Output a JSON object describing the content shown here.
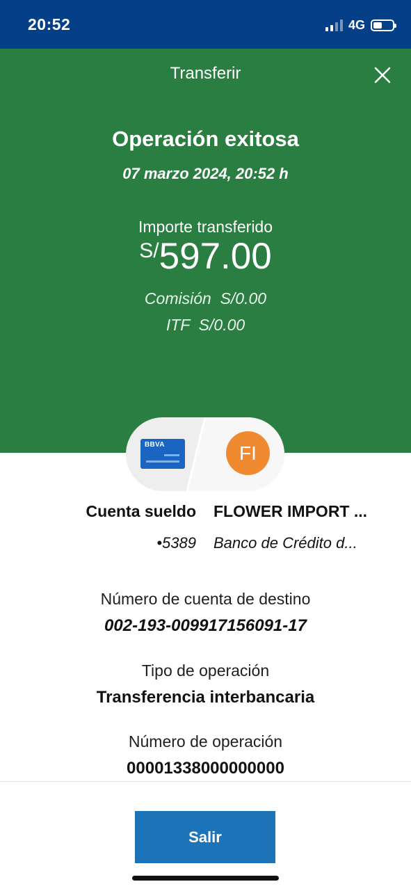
{
  "status_bar": {
    "time": "20:52",
    "network": "4G",
    "signal_bars_active": 2,
    "signal_bars_total": 4,
    "battery_level": 0.45
  },
  "header": {
    "title": "Transferir",
    "close_icon": "close-icon"
  },
  "result": {
    "headline": "Operación exitosa",
    "datetime": "07 marzo 2024, 20:52 h",
    "amount_label": "Importe transferido",
    "currency": "S/",
    "amount": "597.00",
    "commission": "Comisión  S/0.00",
    "itf": "ITF  S/0.00"
  },
  "accounts": {
    "origin": {
      "bank_logo_text": "BBVA",
      "name": "Cuenta sueldo",
      "number": "•5389"
    },
    "destination": {
      "initials": "FI",
      "name": "FLOWER IMPORT ...",
      "bank": "Banco de Crédito d..."
    }
  },
  "details": {
    "dest_account_label": "Número de cuenta de destino",
    "dest_account_value": "002-193-009917156091-17",
    "op_type_label": "Tipo de operación",
    "op_type_value": "Transferencia interbancaria",
    "op_number_label": "Número de operación",
    "op_number_value": "00001338000000000"
  },
  "actions": {
    "exit_label": "Salir"
  },
  "colors": {
    "status_bar": "#043f88",
    "success_green": "#2a7e41",
    "primary_button": "#1d73b8",
    "avatar_orange": "#f08a31"
  }
}
